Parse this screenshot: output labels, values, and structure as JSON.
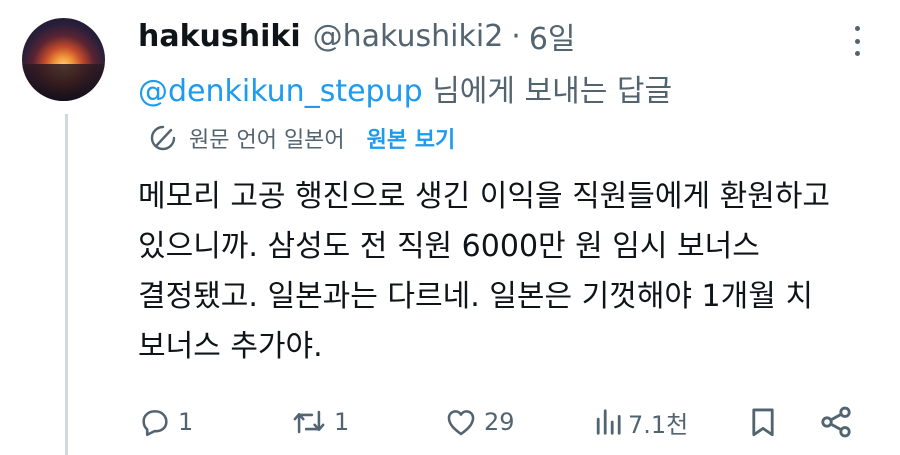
{
  "tweet": {
    "display_name": "hakushiki",
    "handle": "@hakushiki2",
    "separator": "·",
    "time": "6일",
    "reply_mention": "@denkikun_stepup",
    "reply_suffix": "님에게 보내는 답글",
    "translate": {
      "source_lang": "원문 언어 일본어",
      "show_original": "원본 보기"
    },
    "body": "메모리 고공 행진으로 생긴 이익을 직원들에게 환원하고\n있으니까. 삼성도 전 직원 6000만 원 임시 보너스\n결정됐고. 일본과는 다르네. 일본은 기껏해야 1개월 치\n보너스 추가야.",
    "actions": {
      "replies": "1",
      "reposts": "1",
      "likes": "29",
      "views": "7.1천"
    }
  },
  "colors": {
    "accent": "#1d9bf0",
    "secondary_text": "#536471",
    "primary_text": "#0f1419",
    "thread_line": "#cfd9de"
  },
  "icons": [
    "reply-icon",
    "repost-icon",
    "like-icon",
    "views-icon",
    "bookmark-icon",
    "share-icon",
    "translate-icon",
    "more-icon"
  ]
}
